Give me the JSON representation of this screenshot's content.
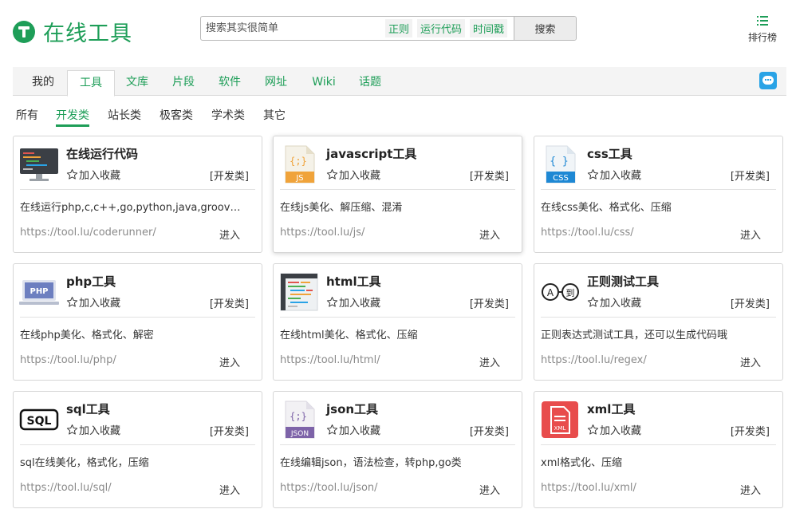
{
  "header": {
    "logo_text": "在线工具",
    "search_placeholder": "搜索其实很简单",
    "quick_tags": [
      "正则",
      "运行代码",
      "时间戳"
    ],
    "search_button": "搜索",
    "rank_label": "排行榜"
  },
  "nav": {
    "tabs": [
      "我的",
      "工具",
      "文库",
      "片段",
      "软件",
      "网址",
      "Wiki",
      "话题"
    ],
    "active_tab": "工具"
  },
  "subcats": {
    "items": [
      "所有",
      "开发类",
      "站长类",
      "极客类",
      "学术类",
      "其它"
    ],
    "active": "开发类"
  },
  "fav_label": "加入收藏",
  "enter_label": "进入",
  "cards": [
    {
      "title": "在线运行代码",
      "icon": "code-runner-icon",
      "category": "[开发类]",
      "desc": "在线运行php,c,c++,go,python,java,groovy…",
      "url": "https://tool.lu/coderunner/"
    },
    {
      "title": "javascript工具",
      "icon": "js-file-icon",
      "category": "[开发类]",
      "desc": "在线js美化、解压缩、混淆",
      "url": "https://tool.lu/js/"
    },
    {
      "title": "css工具",
      "icon": "css-file-icon",
      "category": "[开发类]",
      "desc": "在线css美化、格式化、压缩",
      "url": "https://tool.lu/css/"
    },
    {
      "title": "php工具",
      "icon": "php-laptop-icon",
      "category": "[开发类]",
      "desc": "在线php美化、格式化、解密",
      "url": "https://tool.lu/php/"
    },
    {
      "title": "html工具",
      "icon": "html-code-icon",
      "category": "[开发类]",
      "desc": "在线html美化、格式化、压缩",
      "url": "https://tool.lu/html/"
    },
    {
      "title": "正则测试工具",
      "icon": "regex-icon",
      "category": "[开发类]",
      "desc": "正则表达式测试工具，还可以生成代码哦",
      "url": "https://tool.lu/regex/"
    },
    {
      "title": "sql工具",
      "icon": "sql-icon",
      "category": "[开发类]",
      "desc": "sql在线美化，格式化，压缩",
      "url": "https://tool.lu/sql/"
    },
    {
      "title": "json工具",
      "icon": "json-file-icon",
      "category": "[开发类]",
      "desc": "在线编辑json，语法检查，转php,go类",
      "url": "https://tool.lu/json/"
    },
    {
      "title": "xml工具",
      "icon": "xml-file-icon",
      "category": "[开发类]",
      "desc": "xml格式化、压缩",
      "url": "https://tool.lu/xml/"
    }
  ],
  "icon_text": {
    "js": "JS",
    "css": "CSS",
    "php": "PHP",
    "regex_a": "A",
    "regex_b": "到",
    "sql": "SQL",
    "json": "JSON",
    "xml": "XML",
    "bracket_curly": "{;}",
    "bracket_plain": "{ }"
  },
  "colors": {
    "brand": "#1e9e58",
    "chat": "#29a3e6",
    "js": "#f0a33a",
    "css": "#1e88d4",
    "php": "#6d7fc0",
    "json": "#7d63a8",
    "xml": "#e84c4c"
  }
}
